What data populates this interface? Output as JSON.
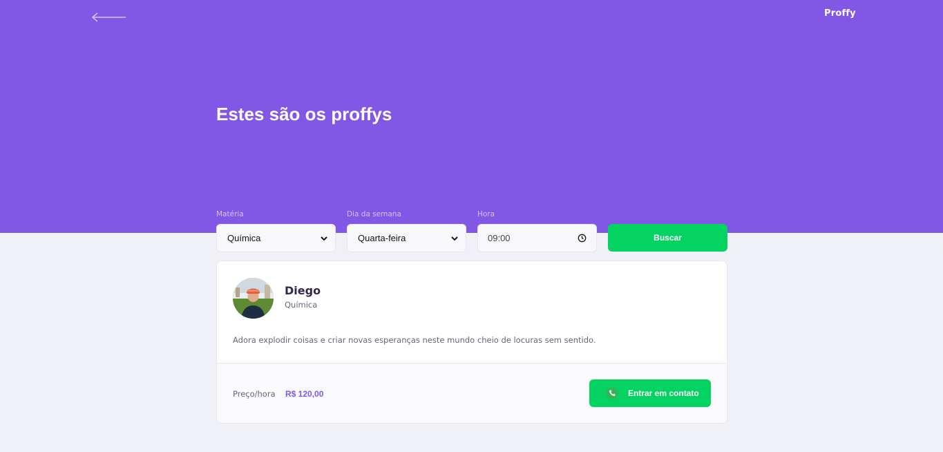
{
  "header": {
    "logo": "Proffy",
    "title": "Estes são os proffys",
    "back_icon": "arrow-left-icon"
  },
  "filters": {
    "subject": {
      "label": "Matéria",
      "value": "Química"
    },
    "weekday": {
      "label": "Dia da semana",
      "value": "Quarta-feira"
    },
    "time": {
      "label": "Hora",
      "value": "09:00",
      "icon": "clock-icon"
    },
    "search_label": "Buscar"
  },
  "teacher": {
    "name": "Diego",
    "subject": "Química",
    "bio": "Adora explodir coisas e criar novas esperanças neste mundo cheio de locuras sem sentido.",
    "price_label": "Preço/hora",
    "price_value": "R$ 120,00",
    "contact_label": "Entrar em contato",
    "contact_icon": "whatsapp-icon"
  },
  "colors": {
    "primary": "#8257E5",
    "secondary": "#04D361",
    "background": "#F0F0F7"
  }
}
